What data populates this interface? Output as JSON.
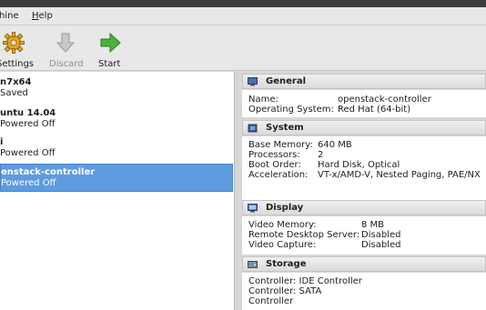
{
  "menu": {
    "items": [
      {
        "label": "hine",
        "mnemonic": ""
      },
      {
        "label": "elp",
        "mnemonic": "H"
      }
    ]
  },
  "toolbar": {
    "settings_label": "Settings",
    "discard_label": "Discard",
    "start_label": "Start",
    "icons": {
      "settings": "gear-icon",
      "discard": "discard-arrow-icon",
      "start": "start-arrow-icon"
    }
  },
  "vms": [
    {
      "name": "n7x64",
      "state": "Saved"
    },
    {
      "name": "untu 14.04",
      "state": "Powered Off"
    },
    {
      "name": "i",
      "state": "Powered Off"
    },
    {
      "name": "enstack-controller",
      "state": "Powered Off",
      "selected": true
    }
  ],
  "details": {
    "general": {
      "title": "General",
      "rows": [
        {
          "key": "Name:",
          "value": "openstack-controller"
        },
        {
          "key": "Operating System:",
          "value": "Red Hat (64-bit)"
        }
      ]
    },
    "system": {
      "title": "System",
      "rows": [
        {
          "key": "Base Memory:",
          "value": "640 MB"
        },
        {
          "key": "Processors:",
          "value": "2"
        },
        {
          "key": "Boot Order:",
          "value": "Hard Disk, Optical"
        },
        {
          "key": "Acceleration:",
          "value": "VT-x/AMD-V, Nested Paging, PAE/NX"
        }
      ]
    },
    "display": {
      "title": "Display",
      "rows": [
        {
          "key": "Video Memory:",
          "value": "8 MB"
        },
        {
          "key": "Remote Desktop Server:",
          "value": "Disabled"
        },
        {
          "key": "Video Capture:",
          "value": "Disabled"
        }
      ]
    },
    "storage": {
      "title": "Storage",
      "rows": [
        {
          "key": "Controller: IDE Controller",
          "value": ""
        },
        {
          "key": "Controller: SATA",
          "value": ""
        },
        {
          "key": "Controller",
          "value": ""
        }
      ]
    }
  },
  "colors": {
    "selection": "#5e9be0",
    "titlebar": "#3c3c3c"
  }
}
